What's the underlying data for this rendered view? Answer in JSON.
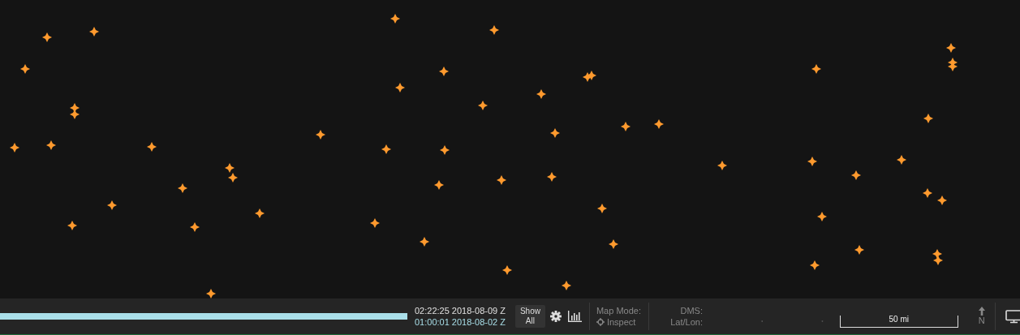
{
  "timeline": {
    "level": 1
  },
  "times": {
    "current": "02:22:25 2018-08-09 Z",
    "start": "01:00:01 2018-08-02 Z"
  },
  "show_all_button": {
    "label": "Show\nAll"
  },
  "map_mode": {
    "label": "Map Mode:",
    "value": "Inspect"
  },
  "coordinates": [
    {
      "label": "DMS:"
    },
    {
      "label": "Lat/Lon:",
      "lat": "°",
      "lon": "°"
    }
  ],
  "scale": {
    "label": "50 mi"
  },
  "north": {
    "label": "N"
  }
}
